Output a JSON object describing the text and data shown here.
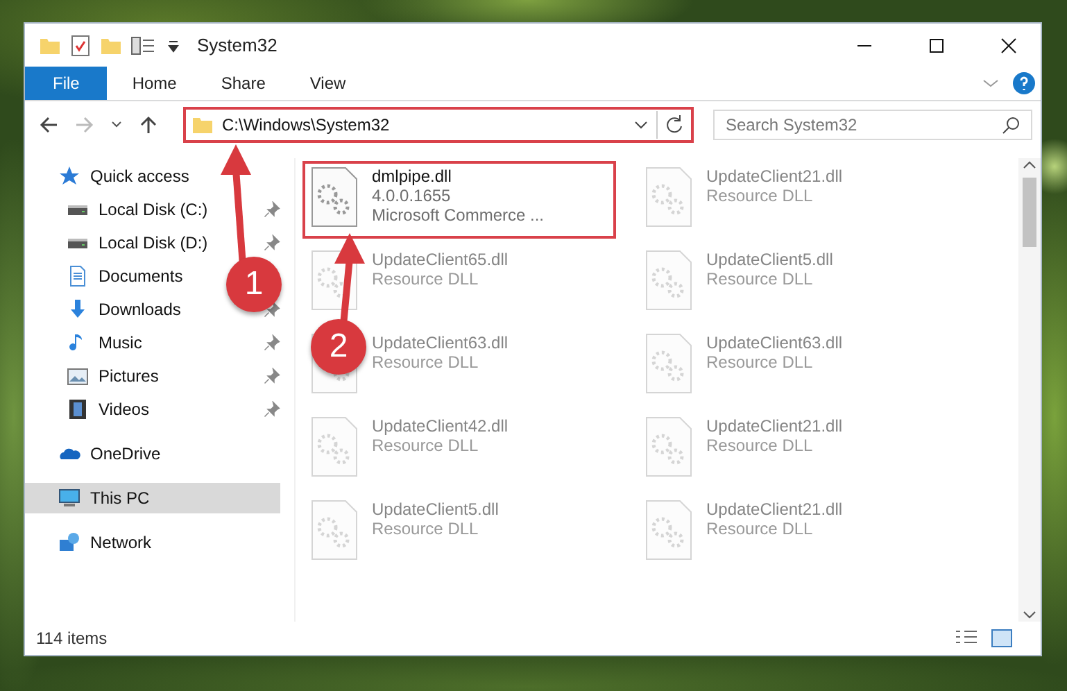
{
  "window": {
    "title": "System32"
  },
  "ribbon_tabs": [
    {
      "label": "File",
      "selected": true
    },
    {
      "label": "Home",
      "selected": false
    },
    {
      "label": "Share",
      "selected": false
    },
    {
      "label": "View",
      "selected": false
    }
  ],
  "address_bar": {
    "path": "C:\\Windows\\System32",
    "highlighted": true
  },
  "search": {
    "placeholder": "Search System32"
  },
  "nav": [
    {
      "label": "Quick access",
      "kind": "star",
      "selected": false,
      "children": [
        {
          "label": "Local Disk (C:)",
          "kind": "disk",
          "pinned": true,
          "selected": false
        },
        {
          "label": "Local Disk (D:)",
          "kind": "disk",
          "pinned": true,
          "selected": false
        },
        {
          "label": "Documents",
          "kind": "document",
          "pinned": false,
          "selected": false
        },
        {
          "label": "Downloads",
          "kind": "download",
          "pinned": true,
          "selected": false
        },
        {
          "label": "Music",
          "kind": "music",
          "pinned": true,
          "selected": false
        },
        {
          "label": "Pictures",
          "kind": "image",
          "pinned": true,
          "selected": false
        },
        {
          "label": "Videos",
          "kind": "film",
          "pinned": true,
          "selected": false
        }
      ]
    },
    {
      "label": "OneDrive",
      "kind": "cloud",
      "selected": false
    },
    {
      "label": "This PC",
      "kind": "computer",
      "selected": true
    },
    {
      "label": "Network",
      "kind": "network",
      "selected": false
    }
  ],
  "files": [
    {
      "name": "dmlpipe.dll",
      "lines": [
        "4.0.0.1655",
        "Microsoft Commerce ..."
      ],
      "highlighted": true,
      "faded": false
    },
    {
      "name": "UpdateClient21.dll",
      "lines": [
        "Resource DLL"
      ],
      "highlighted": false,
      "faded": true
    },
    {
      "name": "UpdateClient65.dll",
      "lines": [
        "Resource DLL"
      ],
      "highlighted": false,
      "faded": true
    },
    {
      "name": "UpdateClient5.dll",
      "lines": [
        "Resource DLL"
      ],
      "highlighted": false,
      "faded": true
    },
    {
      "name": "UpdateClient63.dll",
      "lines": [
        "Resource DLL"
      ],
      "highlighted": false,
      "faded": true
    },
    {
      "name": "UpdateClient63.dll",
      "lines": [
        "Resource DLL"
      ],
      "highlighted": false,
      "faded": true
    },
    {
      "name": "UpdateClient42.dll",
      "lines": [
        "Resource DLL"
      ],
      "highlighted": false,
      "faded": true
    },
    {
      "name": "UpdateClient21.dll",
      "lines": [
        "Resource DLL"
      ],
      "highlighted": false,
      "faded": true
    },
    {
      "name": "UpdateClient5.dll",
      "lines": [
        "Resource DLL"
      ],
      "highlighted": false,
      "faded": true
    },
    {
      "name": "UpdateClient21.dll",
      "lines": [
        "Resource DLL"
      ],
      "highlighted": false,
      "faded": true
    }
  ],
  "status_bar": {
    "count": "114 items"
  },
  "annotations": [
    {
      "number": "1"
    },
    {
      "number": "2"
    }
  ]
}
